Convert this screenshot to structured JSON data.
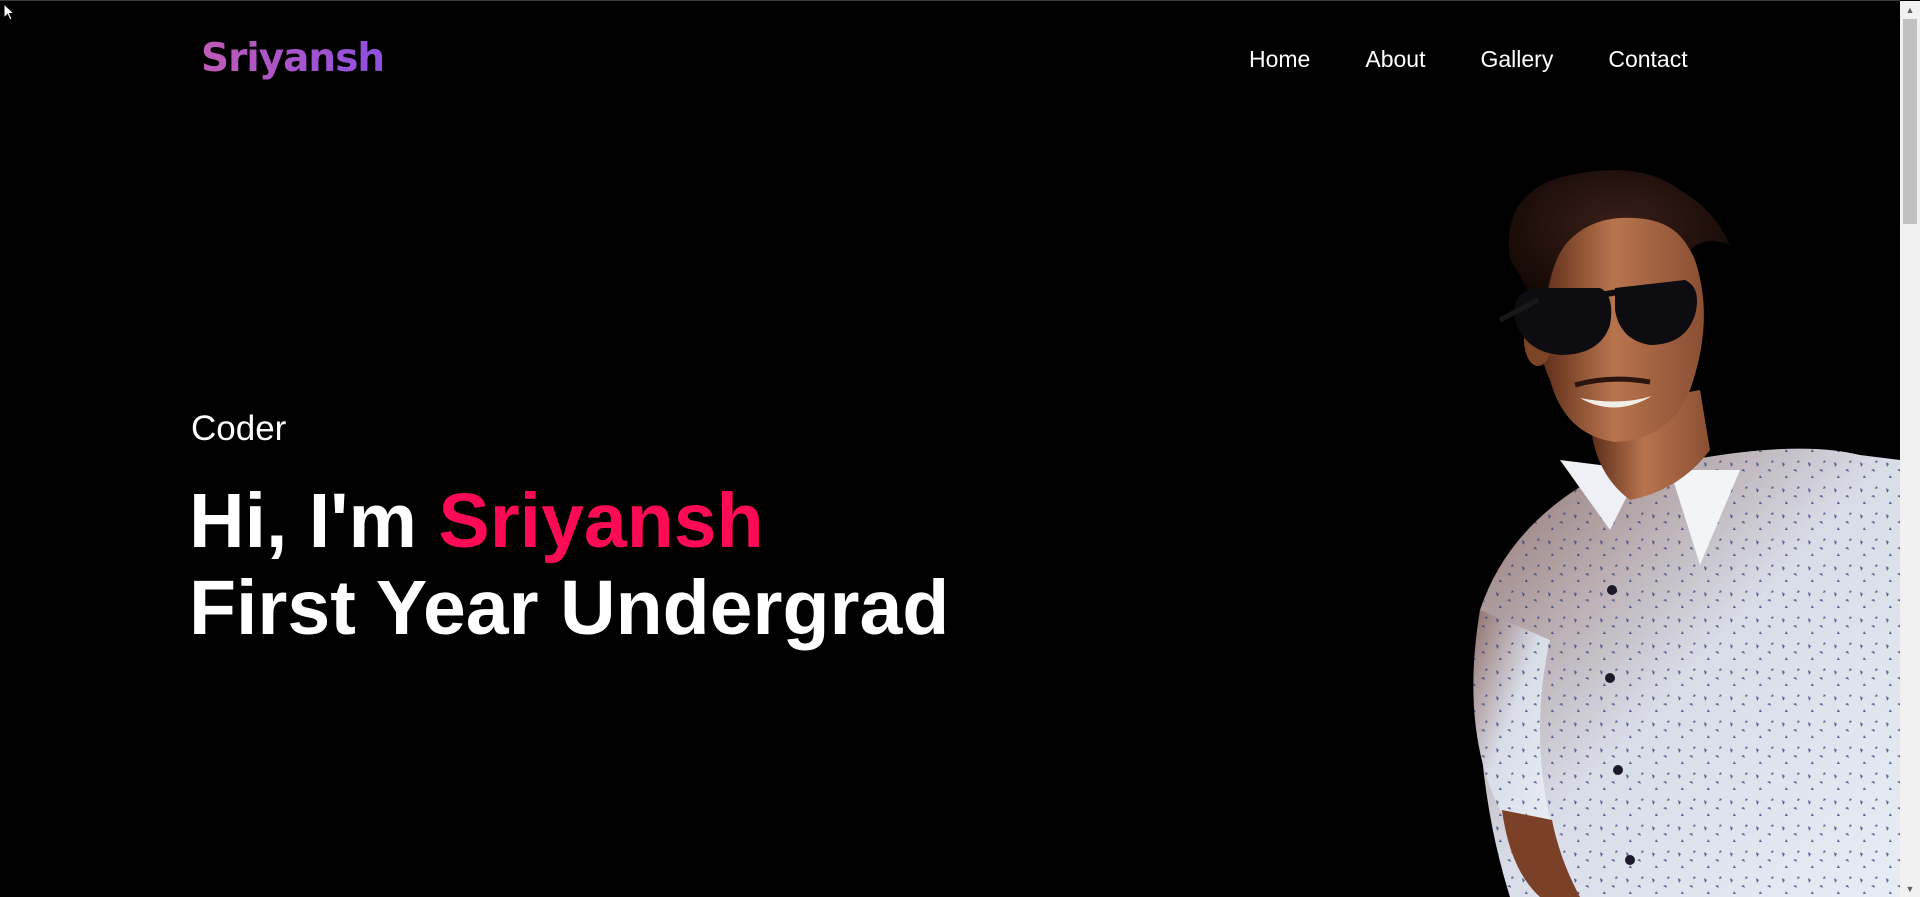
{
  "header": {
    "logo": "Sriyansh",
    "nav": [
      "Home",
      "About",
      "Gallery",
      "Contact"
    ]
  },
  "hero": {
    "role": "Coder",
    "greeting": "Hi, I'm ",
    "name": "Sriyansh",
    "subtitle": "First Year Undergrad"
  },
  "colors": {
    "background": "#000000",
    "accent": "#ff0a54",
    "logo_gradient_start": "#c05ab6",
    "logo_gradient_end": "#8e4fe0",
    "text": "#ffffff"
  },
  "icons": {
    "cursor": "mouse-cursor-icon",
    "scroll_up": "scroll-up-arrow-icon",
    "scroll_down": "scroll-down-arrow-icon"
  }
}
